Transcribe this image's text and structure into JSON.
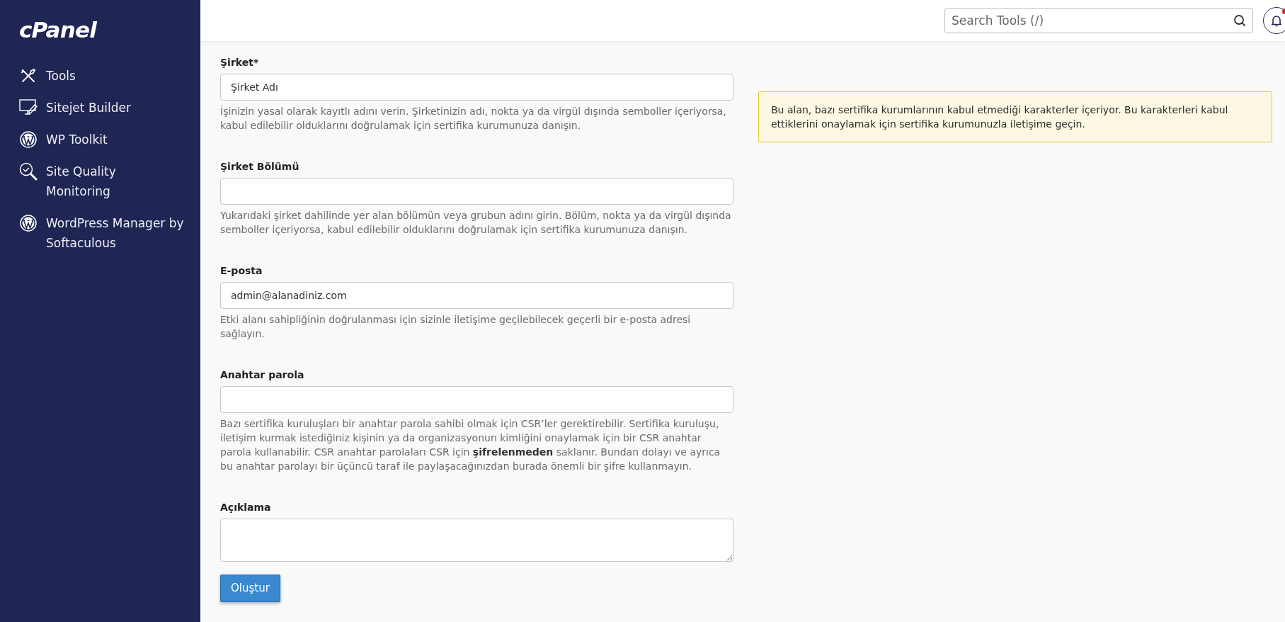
{
  "sidebar": {
    "logo": "cPanel",
    "items": [
      {
        "label": "Tools",
        "kind": "tools"
      },
      {
        "label": "Sitejet Builder",
        "kind": "builder"
      },
      {
        "label": "WP Toolkit",
        "kind": "wordpress"
      },
      {
        "label": "Site Quality Monitoring",
        "kind": "quality"
      },
      {
        "label": "WordPress Manager by Softaculous",
        "kind": "wordpress"
      }
    ]
  },
  "header": {
    "search": {
      "placeholder": "Search Tools (/)"
    },
    "notification_dot": true
  },
  "form": {
    "fields": [
      {
        "label": "Şirket*",
        "kind": "input",
        "value": "Şirket Adı",
        "help": "İşinizin yasal olarak kayıtlı adını verin. Şirketinizin adı, nokta ya da virgül dışında semboller içeriyorsa, kabul edilebilir olduklarını doğrulamak için sertifika kurumunuza danışın."
      },
      {
        "label": "Şirket Bölümü",
        "kind": "input",
        "help": "Yukarıdaki şirket dahilinde yer alan bölümün veya grubun adını girin. Bölüm, nokta ya da virgül dışında semboller içeriyorsa, kabul edilebilir olduklarını doğrulamak için sertifika kurumunuza danışın."
      },
      {
        "label": "E-posta",
        "kind": "input",
        "value": "admin@alanadiniz.com",
        "help": "Etki alanı sahipliğinin doğrulanması için sizinle iletişime geçilebilecek geçerli bir e-posta adresi sağlayın."
      },
      {
        "label": "Anahtar parola",
        "kind": "input",
        "help": "Bazı sertifika kuruluşları bir anahtar parola sahibi olmak için CSR’ler gerektirebilir. Sertifika kuruluşu, iletişim kurmak istediğiniz kişinin ya da organizasyonun kimliğini onaylamak için bir CSR anahtar parola kullanabilir. CSR anahtar parolaları CSR için **şifrelenmeden** saklanır. Bundan dolayı ve ayrıca bu anahtar parolayı bir üçüncü taraf ile paylaşacağınızdan burada önemli bir şifre kullanmayın."
      },
      {
        "label": "Açıklama",
        "kind": "textarea"
      }
    ],
    "submit": "Oluştur"
  },
  "warning": "Bu alan, bazı sertifika kurumlarının kabul etmediği karakterler içeriyor. Bu karakterleri kabul ettiklerini onaylamak için sertifika kurumunuzla iletişime geçin."
}
